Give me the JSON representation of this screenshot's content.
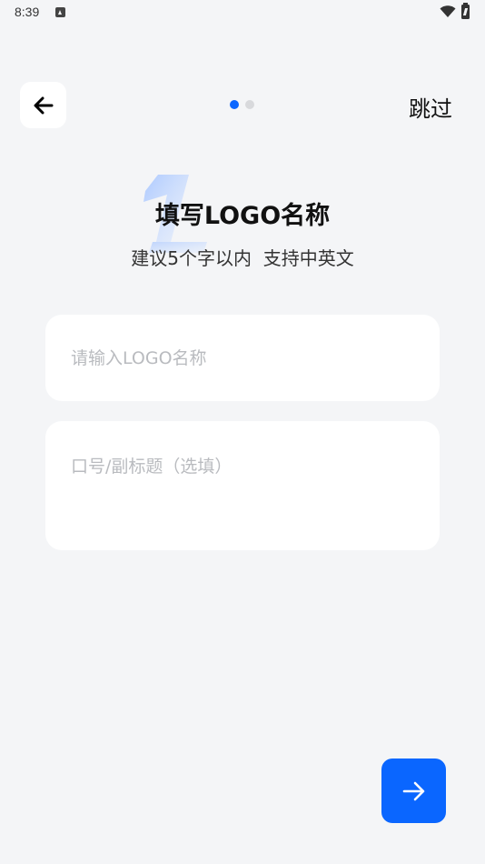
{
  "status_bar": {
    "time": "8:39",
    "notification_icon": "app-notification-icon",
    "wifi_icon": "wifi-icon",
    "battery_icon": "battery-charging-icon"
  },
  "header": {
    "back_icon": "arrow-left-icon",
    "page_indicator": {
      "current": 1,
      "total": 2
    },
    "skip_label": "跳过"
  },
  "title": {
    "step_number": "1",
    "heading": "填写LOGO名称",
    "subtitle": "建议5个字以内  支持中英文"
  },
  "form": {
    "name_input": {
      "value": "",
      "placeholder": "请输入LOGO名称"
    },
    "slogan_input": {
      "value": "",
      "placeholder": "口号/副标题（选填）"
    }
  },
  "footer": {
    "next_icon": "arrow-right-icon"
  },
  "colors": {
    "accent": "#0a66ff",
    "background": "#f4f5f7",
    "card": "#ffffff",
    "placeholder": "#b9bbbf",
    "dot_inactive": "#d8d9dc"
  }
}
